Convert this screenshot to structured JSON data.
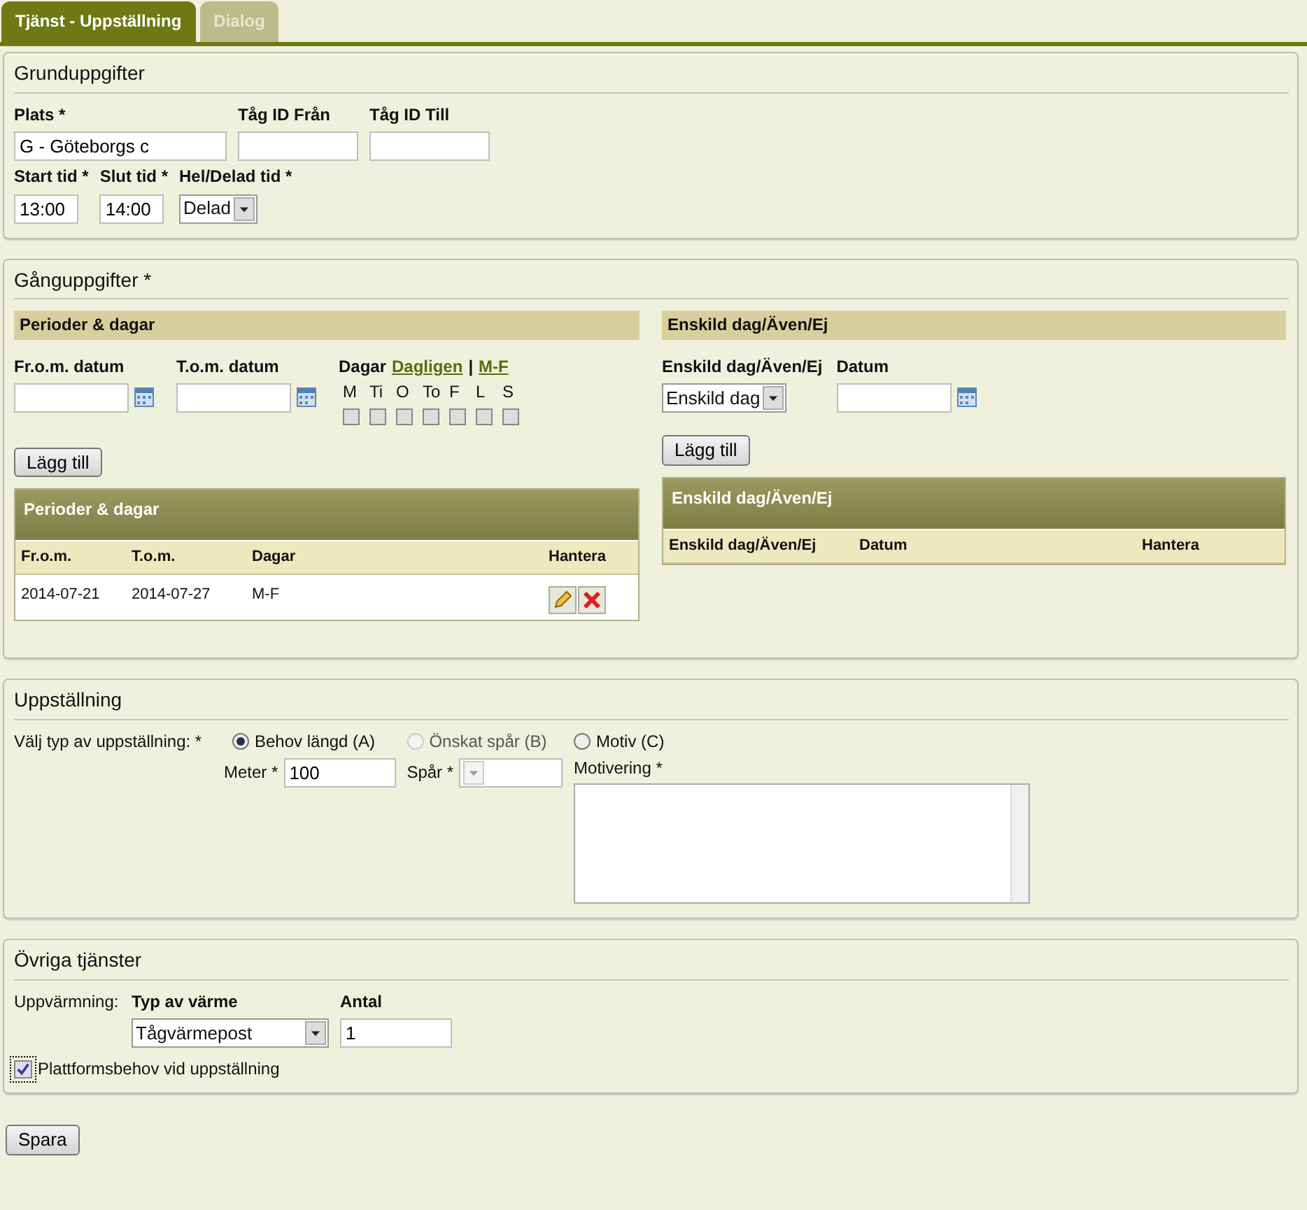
{
  "tabs": [
    {
      "label": "Tjänst - Uppställning",
      "selected": true
    },
    {
      "label": "Dialog",
      "selected": false
    }
  ],
  "grunduppgifter": {
    "title": "Grunduppgifter",
    "row1": [
      {
        "label": "Plats *",
        "value": "G - Göteborgs c",
        "kind": "text"
      },
      {
        "label": "Tåg ID Från",
        "kind": "text"
      },
      {
        "label": "Tåg ID Till",
        "kind": "text"
      }
    ],
    "row2": [
      {
        "label": "Start tid *",
        "value": "13:00",
        "kind": "text"
      },
      {
        "label": "Slut tid *",
        "value": "14:00",
        "kind": "text"
      },
      {
        "label": "Hel/Delad tid *",
        "value": "Delad",
        "kind": "select"
      }
    ]
  },
  "ganguppgifter": {
    "title": "Gånguppgifter *",
    "perioder": {
      "header": "Perioder & dagar",
      "from_label": "Fr.o.m. datum",
      "to_label": "T.o.m. datum",
      "days_label": "Dagar",
      "day_links": [
        "Dagligen",
        "M-F"
      ],
      "separator": "|",
      "days": [
        {
          "label": "M",
          "checked": false
        },
        {
          "label": "Ti",
          "checked": false
        },
        {
          "label": "O",
          "checked": false
        },
        {
          "label": "To",
          "checked": false
        },
        {
          "label": "F",
          "checked": false
        },
        {
          "label": "L",
          "checked": false
        },
        {
          "label": "S",
          "checked": false
        }
      ],
      "add_button": "Lägg till",
      "table": {
        "title": "Perioder & dagar",
        "columns": [
          "Fr.o.m.",
          "T.o.m.",
          "Dagar",
          "Hantera"
        ],
        "rows": [
          [
            "2014-07-21",
            "2014-07-27",
            "M-F"
          ]
        ]
      }
    },
    "enskild": {
      "header": "Enskild dag/Även/Ej",
      "type_label": "Enskild dag/Även/Ej",
      "type_value": "Enskild dag",
      "date_label": "Datum",
      "add_button": "Lägg till",
      "table": {
        "title": "Enskild dag/Även/Ej",
        "columns": [
          "Enskild dag/Även/Ej",
          "Datum",
          "Hantera"
        ]
      }
    }
  },
  "uppstallning": {
    "title": "Uppställning",
    "type_label": "Välj typ av uppställning: *",
    "options": [
      {
        "label": "Behov längd (A)",
        "selected": true,
        "disabled": false,
        "field_label": "Meter *",
        "field_value": "100",
        "kind": "text"
      },
      {
        "label": "Önskat spår (B)",
        "selected": false,
        "disabled": true,
        "field_label": "Spår *",
        "kind": "select"
      },
      {
        "label": "Motiv (C)",
        "selected": false,
        "disabled": false,
        "field_label": "Motivering *",
        "kind": "textarea"
      }
    ]
  },
  "ovriga": {
    "title": "Övriga tjänster",
    "heating_label": "Uppvärmning:",
    "type_label": "Typ av värme",
    "type_value": "Tågvärmepost",
    "count_label": "Antal",
    "count_value": "1",
    "platform": {
      "label": "Plattformsbehov vid uppställning",
      "checked": true
    }
  },
  "save_button": "Spara"
}
